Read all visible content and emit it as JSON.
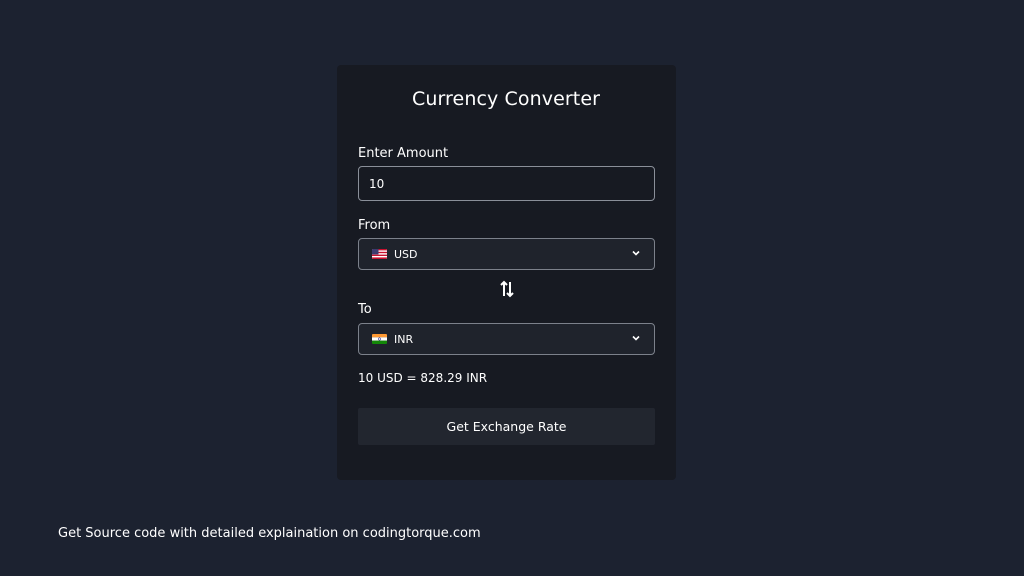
{
  "app": {
    "title": "Currency Converter"
  },
  "form": {
    "amount_label": "Enter Amount",
    "amount_value": "10",
    "from_label": "From",
    "from_currency": "USD",
    "from_flag": "us-flag-icon",
    "to_label": "To",
    "to_currency": "INR",
    "to_flag": "india-flag-icon",
    "swap_icon": "swap-vertical-icon",
    "dropdown_icon": "chevron-down-icon"
  },
  "result": {
    "text": "10 USD = 828.29 INR"
  },
  "actions": {
    "get_rate_label": "Get Exchange Rate"
  },
  "footer": {
    "text": "Get Source code with detailed explaination on codingtorque.com"
  },
  "colors": {
    "page_bg": "#1c2230",
    "card_bg": "#171a22",
    "button_bg": "#22262f",
    "border": "#8a8f99"
  }
}
